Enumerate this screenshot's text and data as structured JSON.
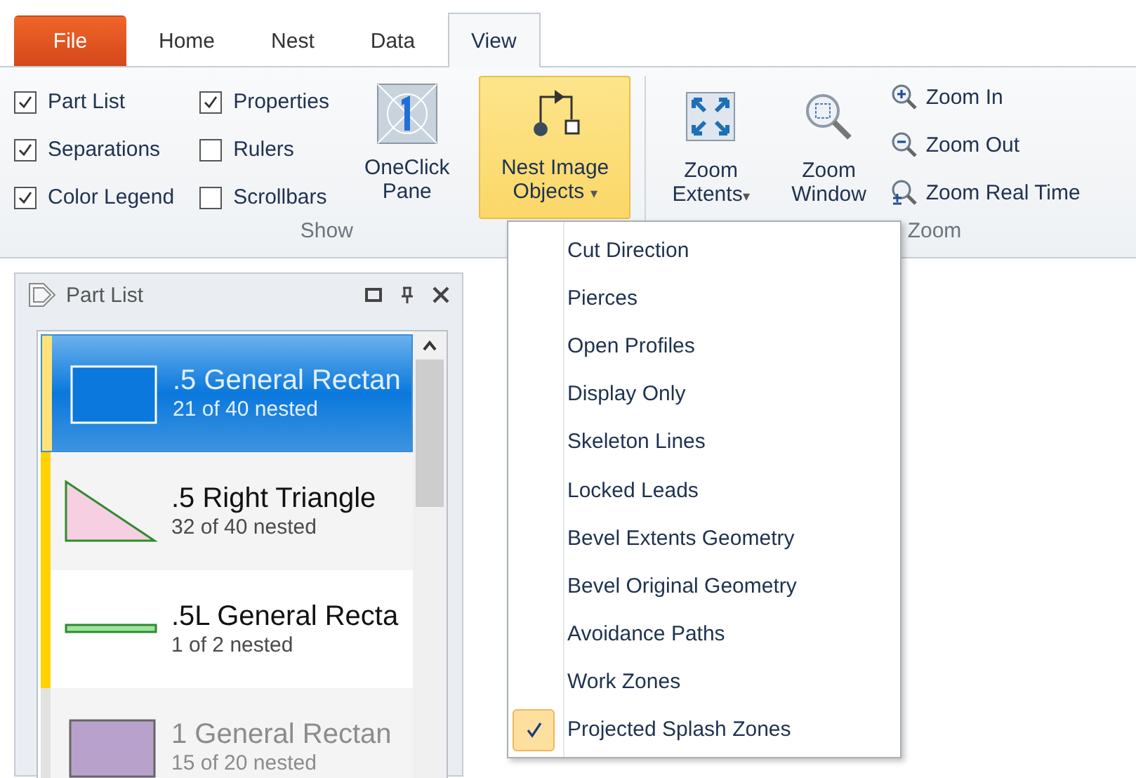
{
  "tabs": [
    {
      "label": "File",
      "kind": "file",
      "selected": false
    },
    {
      "label": "Home",
      "kind": "tab",
      "selected": false
    },
    {
      "label": "Nest",
      "kind": "tab",
      "selected": false
    },
    {
      "label": "Data",
      "kind": "tab",
      "selected": false
    },
    {
      "label": "View",
      "kind": "tab",
      "selected": true
    }
  ],
  "show_group": {
    "label": "Show",
    "checkboxes": [
      {
        "label": "Part List",
        "checked": true
      },
      {
        "label": "Separations",
        "checked": true
      },
      {
        "label": "Color Legend",
        "checked": true
      },
      {
        "label": "Properties",
        "checked": true
      },
      {
        "label": "Rulers",
        "checked": false
      },
      {
        "label": "Scrollbars",
        "checked": false
      }
    ],
    "oneclick_button": {
      "lines": [
        "OneClick",
        "Pane"
      ]
    },
    "nest_image_button": {
      "lines": [
        "Nest Image",
        "Objects"
      ],
      "caret": "▾",
      "selected": true
    }
  },
  "zoom_group": {
    "label": "Zoom",
    "large_buttons": [
      {
        "lines": [
          "Zoom",
          "Extents"
        ],
        "kind": "extents",
        "caret": "▾"
      },
      {
        "lines": [
          "Zoom",
          "Window"
        ],
        "kind": "window"
      }
    ],
    "small_buttons": [
      {
        "label": "Zoom In",
        "kind": "in"
      },
      {
        "label": "Zoom Out",
        "kind": "out"
      },
      {
        "label": "Zoom Real Time",
        "kind": "realtime"
      }
    ]
  },
  "part_list": {
    "title": "Part List",
    "items": [
      {
        "name": ".5 General Rectan",
        "count": "21 of 40 nested",
        "kind": "rectangle",
        "color": "#0a78dc",
        "marked": true,
        "selected": true,
        "dimmed": false
      },
      {
        "name": ".5 Right Triangle",
        "count": "32 of 40 nested",
        "kind": "triangle",
        "color": "#f7cfe3",
        "marked": true,
        "selected": false,
        "dimmed": false
      },
      {
        "name": ".5L General Recta",
        "count": "1 of 2 nested",
        "kind": "strip",
        "color": "#9fe39f",
        "marked": true,
        "selected": false,
        "dimmed": false
      },
      {
        "name": "1 General Rectan",
        "count": "15 of 20 nested",
        "kind": "rectangle",
        "color": "#b8a2cb",
        "marked": false,
        "selected": false,
        "dimmed": true
      }
    ]
  },
  "menu": {
    "items": [
      {
        "label": "Cut Direction",
        "checked": false
      },
      {
        "label": "Pierces",
        "checked": false
      },
      {
        "label": "Open Profiles",
        "checked": false
      },
      {
        "label": "Display Only",
        "checked": false
      },
      {
        "label": "Skeleton Lines",
        "checked": false
      },
      {
        "label": "Locked Leads",
        "checked": false
      },
      {
        "label": "Bevel Extents Geometry",
        "checked": false
      },
      {
        "label": "Bevel Original Geometry",
        "checked": false
      },
      {
        "label": "Avoidance Paths",
        "checked": false
      },
      {
        "label": "Work Zones",
        "checked": false
      },
      {
        "label": "Projected Splash Zones",
        "checked": true
      }
    ]
  }
}
